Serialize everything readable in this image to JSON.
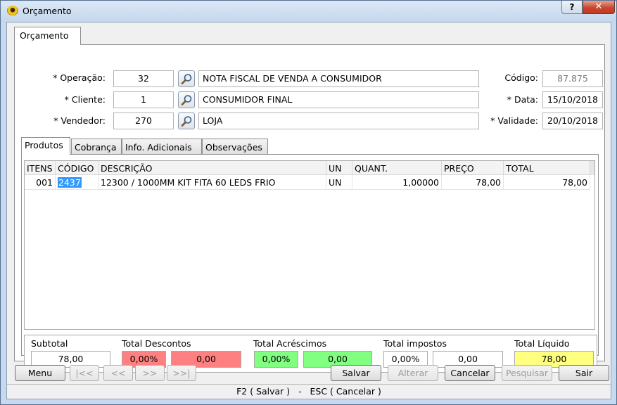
{
  "window": {
    "title": "Orçamento",
    "help_label": "?",
    "close_label": "✕"
  },
  "tab_main": "Orçamento",
  "form": {
    "operacao": {
      "label": "* Operação:",
      "code": "32",
      "desc": "NOTA FISCAL DE VENDA A CONSUMIDOR"
    },
    "cliente": {
      "label": "* Cliente:",
      "code": "1",
      "desc": "CONSUMIDOR FINAL"
    },
    "vendedor": {
      "label": "* Vendedor:",
      "code": "270",
      "desc": "LOJA"
    },
    "codigo": {
      "label": "Código:",
      "value": "87.875"
    },
    "data": {
      "label": "* Data:",
      "value": "15/10/2018"
    },
    "validade": {
      "label": "* Validade:",
      "value": "20/10/2018"
    }
  },
  "inner_tabs": [
    "Produtos",
    "Cobrança",
    "Info. Adicionais",
    "Observações"
  ],
  "grid": {
    "headers": [
      "ITENS",
      "CÓDIGO",
      "DESCRIÇÃO",
      "UN",
      "QUANT.",
      "PREÇO",
      "TOTAL"
    ],
    "rows": [
      {
        "item": "001",
        "codigo": "2437",
        "descricao": "12300 / 1000MM KIT FITA 60 LEDS FRIO",
        "un": "UN",
        "quant": "1,00000",
        "preco": "78,00",
        "total": "78,00"
      }
    ]
  },
  "totals": {
    "subtotal": {
      "label": "Subtotal",
      "value": "78,00"
    },
    "descontos": {
      "label": "Total Descontos",
      "pct": "0,00%",
      "value": "0,00"
    },
    "acrescimos": {
      "label": "Total Acréscimos",
      "pct": "0,00%",
      "value": "0,00"
    },
    "impostos": {
      "label": "Total impostos",
      "pct": "0,00%",
      "value": "0,00"
    },
    "liquido": {
      "label": "Total Líquido",
      "value": "78,00"
    }
  },
  "colors": {
    "desconto": "#ff8080",
    "acrescimo": "#80ff80",
    "liquido": "#ffff80"
  },
  "buttons": {
    "menu": "Menu",
    "first": "|<<",
    "prev": "<<",
    "next": ">>",
    "last": ">>|",
    "salvar": "Salvar",
    "alterar": "Alterar",
    "cancelar": "Cancelar",
    "pesquisar": "Pesquisar",
    "sair": "Sair"
  },
  "status": "F2 ( Salvar )   -   ESC ( Cancelar )",
  "icons": {
    "app": "app-logo-icon",
    "search": "magnifier-icon"
  }
}
